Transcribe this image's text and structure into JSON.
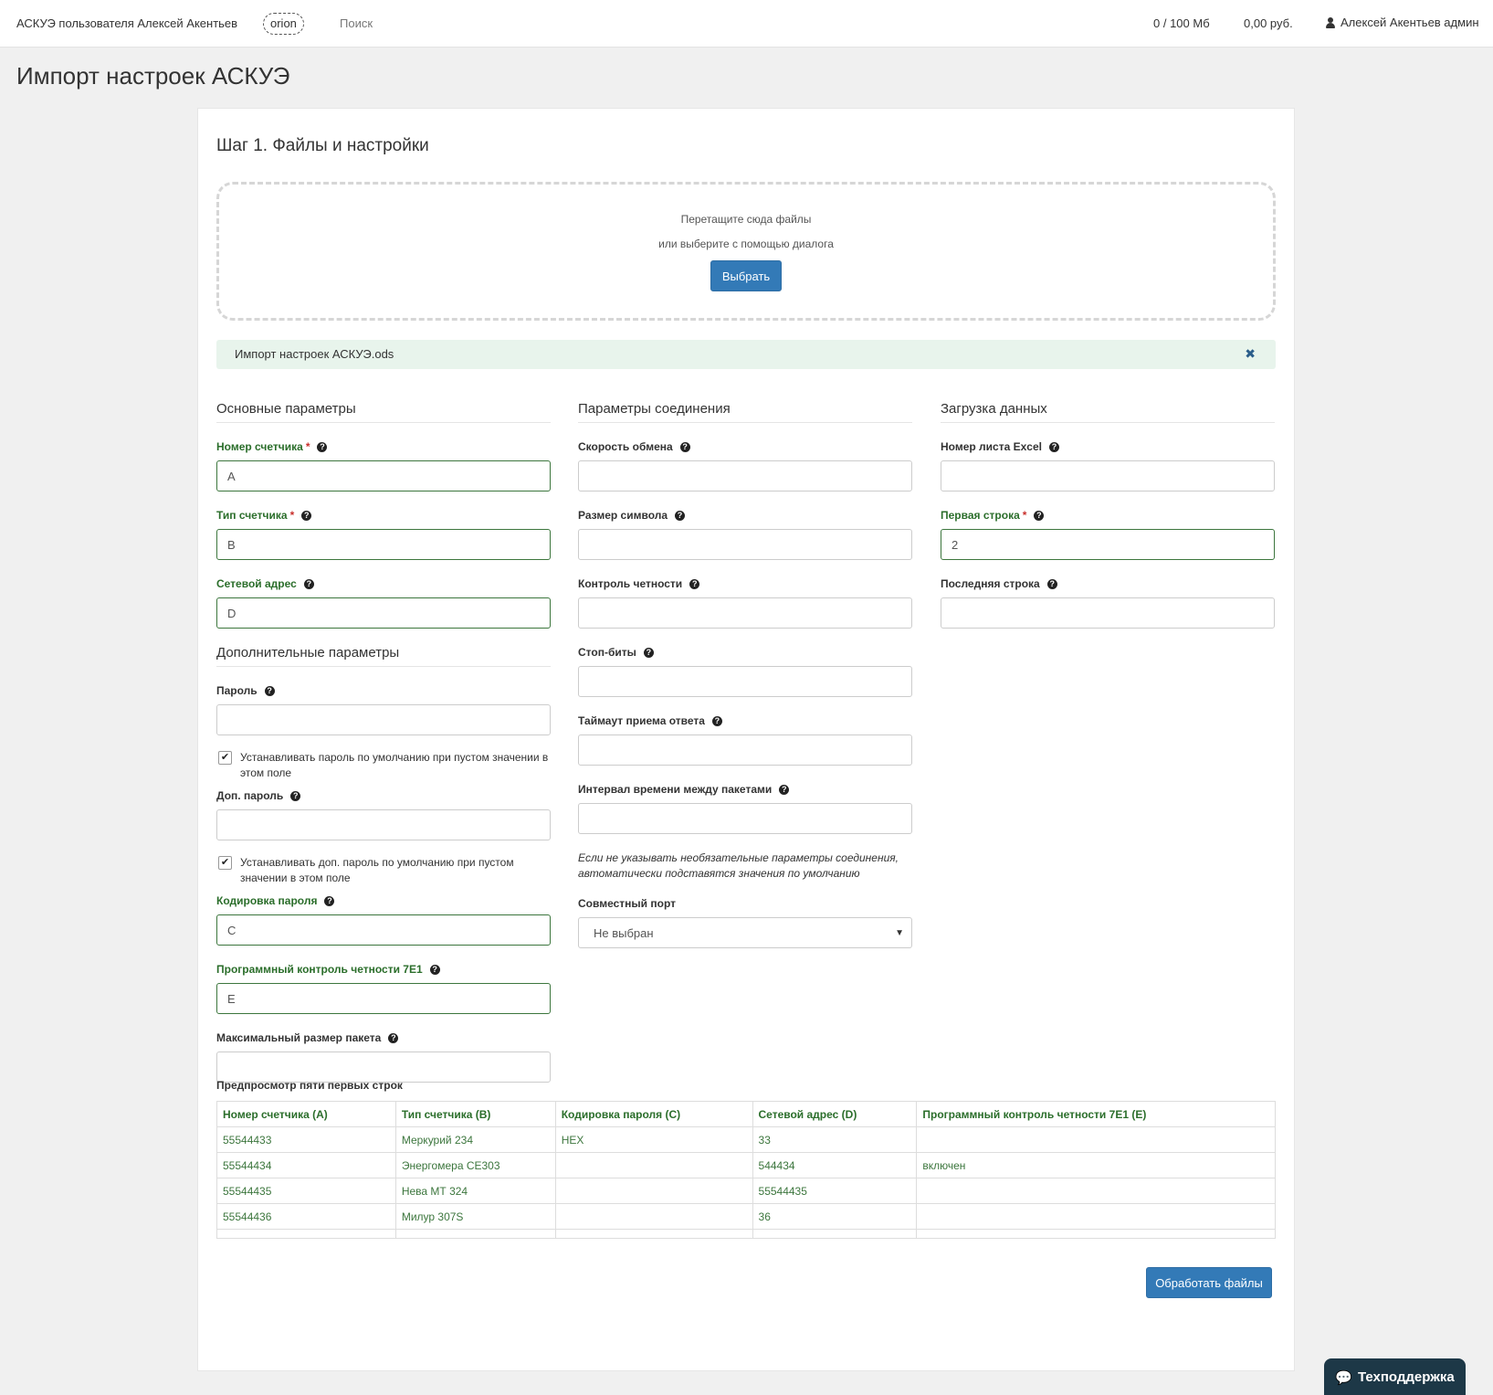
{
  "header": {
    "brand": "АСКУЭ пользователя Алексей Акентьев",
    "server": "orion",
    "search": "Поиск",
    "storage": "0 / 100 Мб",
    "balance": "0,00 руб.",
    "user": "Алексей Акентьев админ"
  },
  "page_title": "Импорт настроек АСКУЭ",
  "step": {
    "title": "Шаг 1. Файлы и настройки",
    "dropzone_text": "Перетащите сюда файлы",
    "dropzone_subtext": "или выберите с помощью диалога",
    "choose_button": "Выбрать",
    "file_name": "Импорт настроек АСКУЭ.ods",
    "remove_glyph": "✖"
  },
  "main_params": {
    "title": "Основные параметры",
    "meter_number": {
      "label": "Номер счетчика",
      "value": "A"
    },
    "meter_type": {
      "label": "Тип счетчика",
      "value": "B"
    },
    "network_address": {
      "label": "Сетевой адрес",
      "value": "D"
    }
  },
  "extra_params": {
    "title": "Дополнительные параметры",
    "password": {
      "label": "Пароль",
      "value": ""
    },
    "password_default": {
      "label": "Устанавливать пароль по умолчанию при пустом значении в этом поле",
      "checked": true
    },
    "extra_password": {
      "label": "Доп. пароль",
      "value": ""
    },
    "extra_password_default": {
      "label": "Устанавливать доп. пароль по умолчанию при пустом значении в этом поле",
      "checked": true
    },
    "password_encoding": {
      "label": "Кодировка пароля",
      "value": "C"
    },
    "parity_7e1": {
      "label": "Программный контроль четности 7E1",
      "value": "E"
    },
    "max_packet": {
      "label": "Максимальный размер пакета",
      "value": ""
    }
  },
  "connection_params": {
    "title": "Параметры соединения",
    "baud_rate": {
      "label": "Скорость обмена",
      "value": ""
    },
    "char_size": {
      "label": "Размер символа",
      "value": ""
    },
    "parity": {
      "label": "Контроль четности",
      "value": ""
    },
    "stop_bits": {
      "label": "Стоп-биты",
      "value": ""
    },
    "response_timeout": {
      "label": "Таймаут приема ответа",
      "value": ""
    },
    "packet_interval": {
      "label": "Интервал времени между пакетами",
      "value": ""
    },
    "note": "Если не указывать необязательные параметры соединения, автоматически подставятся значения по умолчанию",
    "shared_port": {
      "label": "Совместный порт",
      "value": "Не выбран"
    }
  },
  "data_load": {
    "title": "Загрузка данных",
    "sheet_number": {
      "label": "Номер листа Excel",
      "value": ""
    },
    "first_row": {
      "label": "Первая строка",
      "value": "2"
    },
    "last_row": {
      "label": "Последняя строка",
      "value": ""
    }
  },
  "preview": {
    "title": "Предпросмотр пяти первых строк",
    "columns": [
      "Номер счетчика (A)",
      "Тип счетчика (B)",
      "Кодировка пароля (C)",
      "Сетевой адрес (D)",
      "Программный контроль четности 7E1 (E)"
    ],
    "rows": [
      [
        "55544433",
        "Меркурий 234",
        "HEX",
        "33",
        ""
      ],
      [
        "55544434",
        "Энергомера CE303",
        "",
        "544434",
        "включен"
      ],
      [
        "55544435",
        "Нева МТ 324",
        "",
        "55544435",
        ""
      ],
      [
        "55544436",
        "Милур 307S",
        "",
        "36",
        ""
      ]
    ]
  },
  "process_button": "Обработать файлы",
  "support_button": "Техподдержка",
  "colors": {
    "primary": "#337ab7",
    "valid_border": "#3c763d",
    "required_star": "#c9302c",
    "file_row_bg": "#e8f4ec",
    "support_bg": "#1d3847"
  }
}
